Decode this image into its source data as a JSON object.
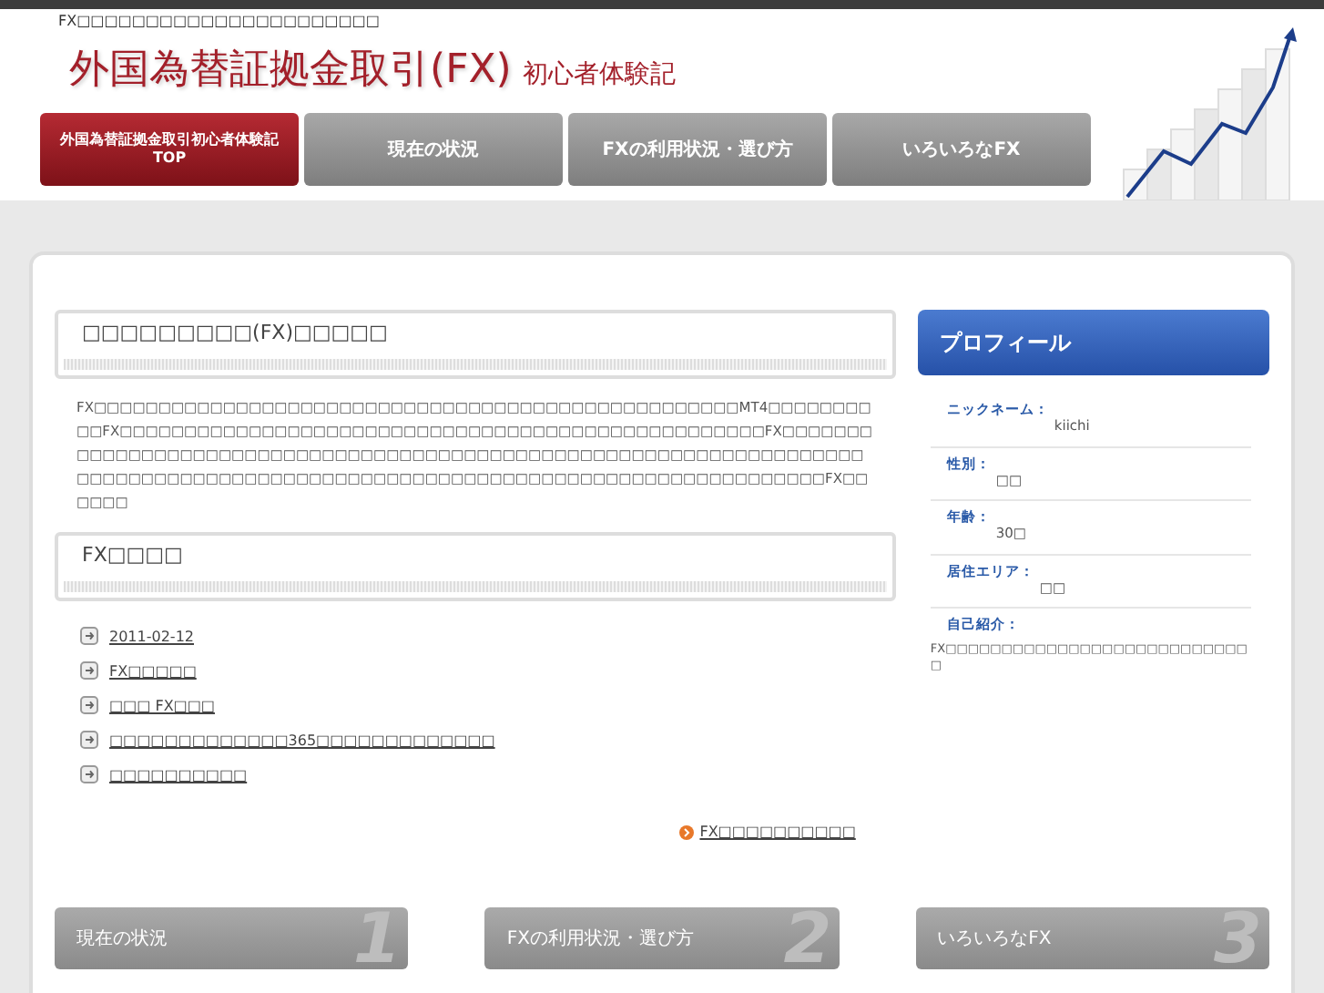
{
  "header": {
    "tagline": "FX□□□□□□□□□□□□□□□□□□□□□□",
    "title": "外国為替証拠金取引(FX)",
    "subtitle": "初心者体験記"
  },
  "nav": [
    {
      "label": "外国為替証拠金取引初心者体験記",
      "sub": "TOP",
      "selected": true
    },
    {
      "label": "現在の状況",
      "selected": false
    },
    {
      "label": "FXの利用状況・選び方",
      "selected": false
    },
    {
      "label": "いろいろなFX",
      "selected": false
    }
  ],
  "intro": {
    "heading": "□□□□□□□□□(FX)□□□□□",
    "text": "FX□□□□□□□□□□□□□□□□□□□□□□□□□□□□□□□□□□□□□□□□□□□□□□□□□□MT4□□□□□□□□□□FX□□□□□□□□□□□□□□□□□□□□□□□□□□□□□□□□□□□□□□□□□□□□□□□□□□FX□□□□□□□□□□□□□□□□□□□□□□□□□□□□□□□□□□□□□□□□□□□□□□□□□□□□□□□□□□□□□□□□□□□□□□□□□□□□□□□□□□□□□□□□□□□□□□□□□□□□□□□□□□□□□□□□□□□□□□□□□□□□□□FX□□□□□□"
  },
  "news": {
    "heading": "FX□□□□",
    "items": [
      "2011-02-12",
      "FX□□□□□",
      "□□□ FX□□□",
      "□□□□□□□□□□□□□365□□□□□□□□□□□□□",
      "□□□□□□□□□□"
    ],
    "more": "FX□□□□□□□□□□"
  },
  "profile": {
    "title": "プロフィール",
    "fields": [
      {
        "label": "ニックネーム：",
        "value": "kiichi"
      },
      {
        "label": "性別：",
        "value": "□□"
      },
      {
        "label": "年齢：",
        "value": "30□"
      },
      {
        "label": "居住エリア：",
        "value": "□□"
      },
      {
        "label": "自己紹介：",
        "value": "FX□□□□□□□□□□□□□□□□□□□□□□□□□□□□"
      }
    ]
  },
  "footer_links": [
    {
      "label": "現在の状況",
      "number": "1"
    },
    {
      "label": "FXの利用状況・選び方",
      "number": "2"
    },
    {
      "label": "いろいろなFX",
      "number": "3"
    }
  ]
}
